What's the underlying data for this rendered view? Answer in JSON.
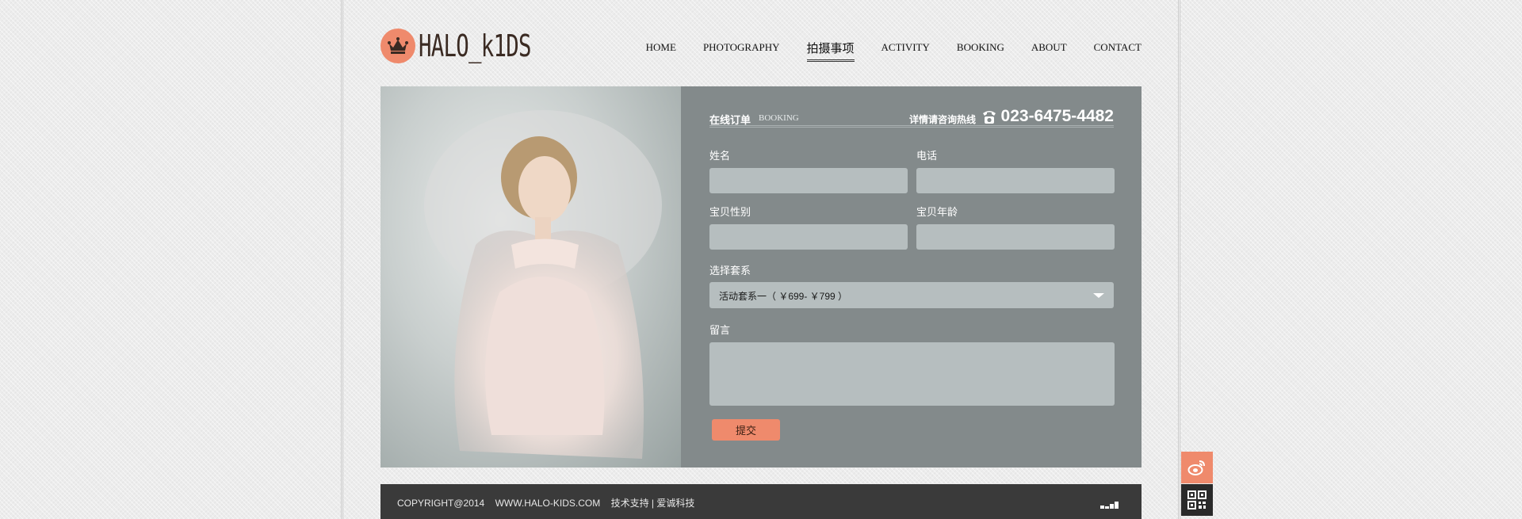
{
  "header": {
    "logo_text": "HALO_k1DS",
    "nav": [
      "HOME",
      "PHOTOGRAPHY",
      "拍摄事项",
      "ACTIVITY",
      "BOOKING",
      "ABOUT",
      "CONTACT"
    ],
    "active_nav": "拍摄事项"
  },
  "booking": {
    "title": "在线订单",
    "subtitle": "BOOKING",
    "hotline_label": "详情请咨询热线",
    "phone": "023-6475-4482",
    "fields": {
      "name_label": "姓名",
      "phone_label": "电话",
      "gender_label": "宝贝性别",
      "age_label": "宝贝年龄",
      "package_label": "选择套系",
      "package_value": "活动套系一（ ￥699- ￥799 ）",
      "message_label": "留言"
    },
    "submit_label": "提交"
  },
  "footer": {
    "copyright": "COPYRIGHT@2014",
    "site": "WWW.HALO-KIDS.COM",
    "support": "技术支持 | 爱诚科技"
  },
  "icons": {
    "logo": "crown-icon",
    "phone": "phone-icon",
    "footer": "signal-icon",
    "side_top": "weibo-icon",
    "side_bottom": "qr-code-icon"
  },
  "colors": {
    "accent": "#ef8a6c",
    "panel": "#838a8b",
    "input": "#b6bebf",
    "footer": "#3a3a3a"
  }
}
